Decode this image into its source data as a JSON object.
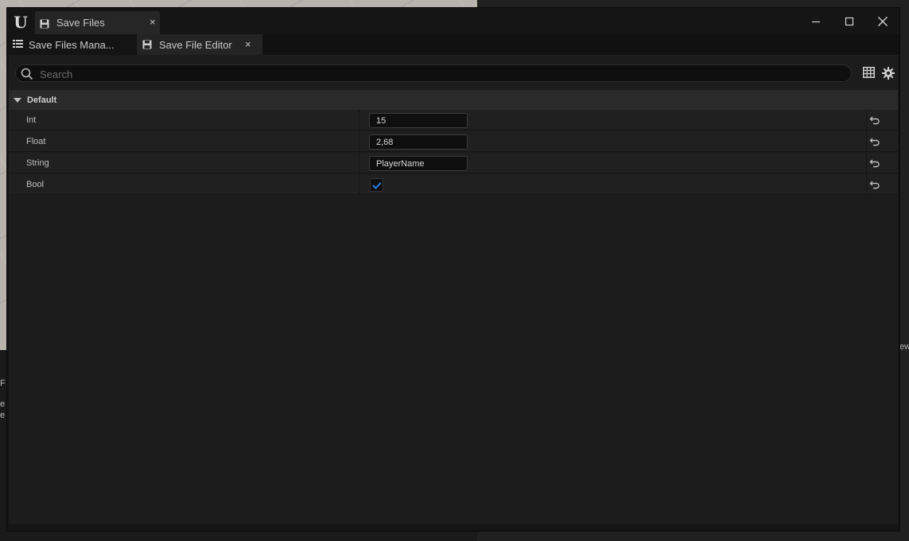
{
  "window": {
    "title": "Save Files",
    "close_tab_glyph": "×",
    "controls": [
      "minimize-icon",
      "maximize-icon",
      "close-icon"
    ]
  },
  "tabs": [
    {
      "label": "Save Files Mana...",
      "icon": "list-icon",
      "active": false
    },
    {
      "label": "Save File Editor",
      "icon": "floppy-disk-icon",
      "active": true,
      "close_glyph": "×"
    }
  ],
  "search": {
    "placeholder": "Search",
    "value": ""
  },
  "toolbar": {
    "icons": [
      "table-view-icon",
      "settings-gear-icon"
    ]
  },
  "category": {
    "label": "Default",
    "expanded": true
  },
  "properties": [
    {
      "name": "Int",
      "type": "number",
      "value": "15"
    },
    {
      "name": "Float",
      "type": "number",
      "value": "2,68"
    },
    {
      "name": "String",
      "type": "text",
      "value": "PlayerName"
    },
    {
      "name": "Bool",
      "type": "bool",
      "checked": true
    }
  ],
  "background": {
    "left_letters": [
      "F",
      "e",
      "e"
    ],
    "right_fragment": "ew"
  },
  "colors": {
    "accent_check": "#2a7de1",
    "panel": "#1c1c1c",
    "row": "#202020",
    "category": "#2a2a2a"
  }
}
